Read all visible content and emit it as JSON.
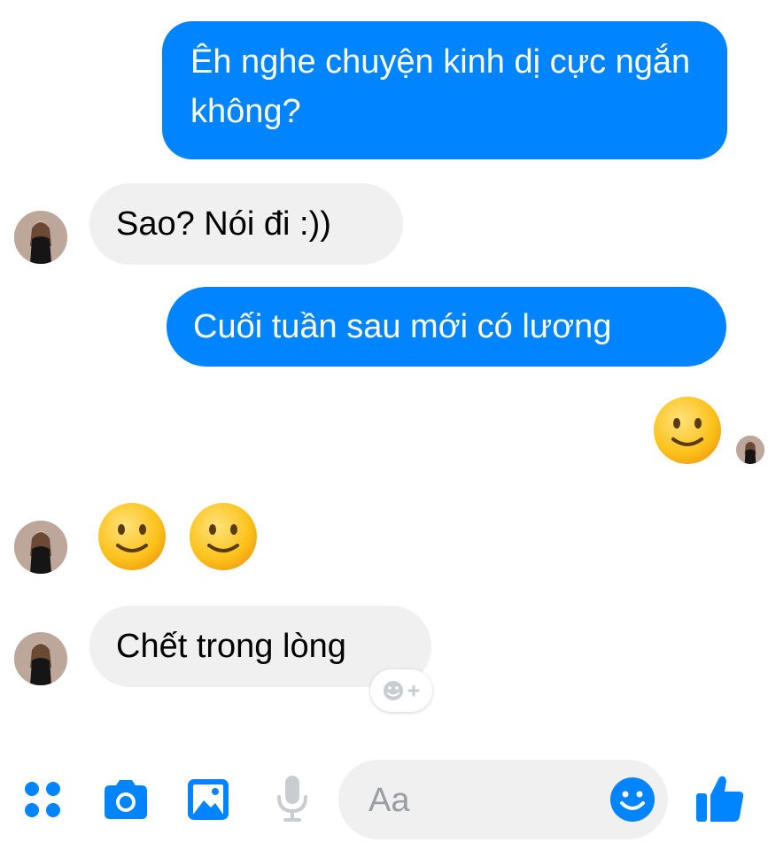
{
  "accent_color": "#0084ff",
  "messages": [
    {
      "from": "me",
      "text": "Êh nghe chuyện kinh dị cực ngắn không?"
    },
    {
      "from": "contact",
      "text": "Sao? Nói đi :))"
    },
    {
      "from": "me",
      "text": "Cuối tuần sau mới có lương"
    },
    {
      "from": "me",
      "emoji": "slightly-smiling-face"
    },
    {
      "from": "contact",
      "emoji": [
        "slightly-smiling-face",
        "slightly-smiling-face"
      ]
    },
    {
      "from": "contact",
      "text": "Chết trong lòng"
    }
  ],
  "composer": {
    "placeholder": "Aa",
    "icons": [
      "more-apps-icon",
      "camera-icon",
      "image-icon",
      "microphone-icon",
      "emoji-icon",
      "like-icon"
    ]
  }
}
